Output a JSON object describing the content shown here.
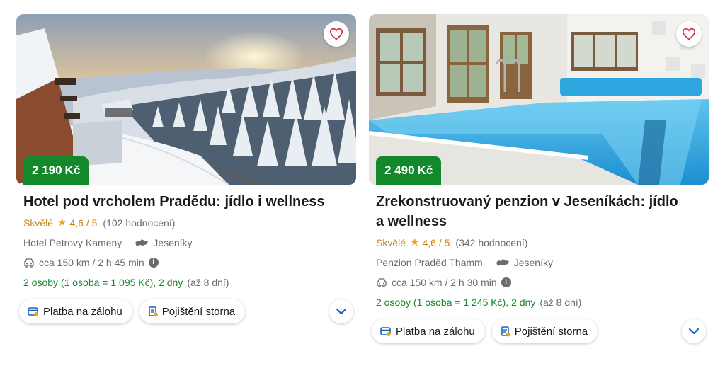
{
  "colors": {
    "price_green": "#14892c",
    "rating_orange": "#c9810d",
    "star": "#f0a30a",
    "link_blue": "#1565c0"
  },
  "cards": [
    {
      "price_amount": "2 190",
      "price_currency": "Kč",
      "title": "Hotel pod vrcholem Pradědu: jídlo i wellness",
      "rating_label": "Skvělé",
      "rating_score": "4,6 / 5",
      "review_count": "(102 hodnocení)",
      "hotel_name": "Hotel Petrovy Kameny",
      "region": "Jeseníky",
      "distance": "cca 150 km / 2 h 45 min",
      "offer": "2 osoby (1 osoba = 1 095 Kč), 2 dny",
      "offer_suffix": "(až 8 dní)",
      "chip_payment": "Platba na zálohu",
      "chip_insurance": "Pojištění storna",
      "icons": {
        "favorite": "heart-icon",
        "car": "car-icon",
        "region": "map-region-icon",
        "info": "info-icon",
        "expand": "chevron-down-icon"
      }
    },
    {
      "price_amount": "2 490",
      "price_currency": "Kč",
      "title": "Zrekonstruovaný penzion v Jeseníkách: jídlo a wellness",
      "rating_label": "Skvělé",
      "rating_score": "4,6 / 5",
      "review_count": "(342 hodnocení)",
      "hotel_name": "Penzion Praděd Thamm",
      "region": "Jeseníky",
      "distance": "cca 150 km / 2 h 30 min",
      "offer": "2 osoby (1 osoba = 1 245 Kč), 2 dny",
      "offer_suffix": "(až 8 dní)",
      "chip_payment": "Platba na zálohu",
      "chip_insurance": "Pojištění storna",
      "icons": {
        "favorite": "heart-icon",
        "car": "car-icon",
        "region": "map-region-icon",
        "info": "info-icon",
        "expand": "chevron-down-icon"
      }
    }
  ]
}
